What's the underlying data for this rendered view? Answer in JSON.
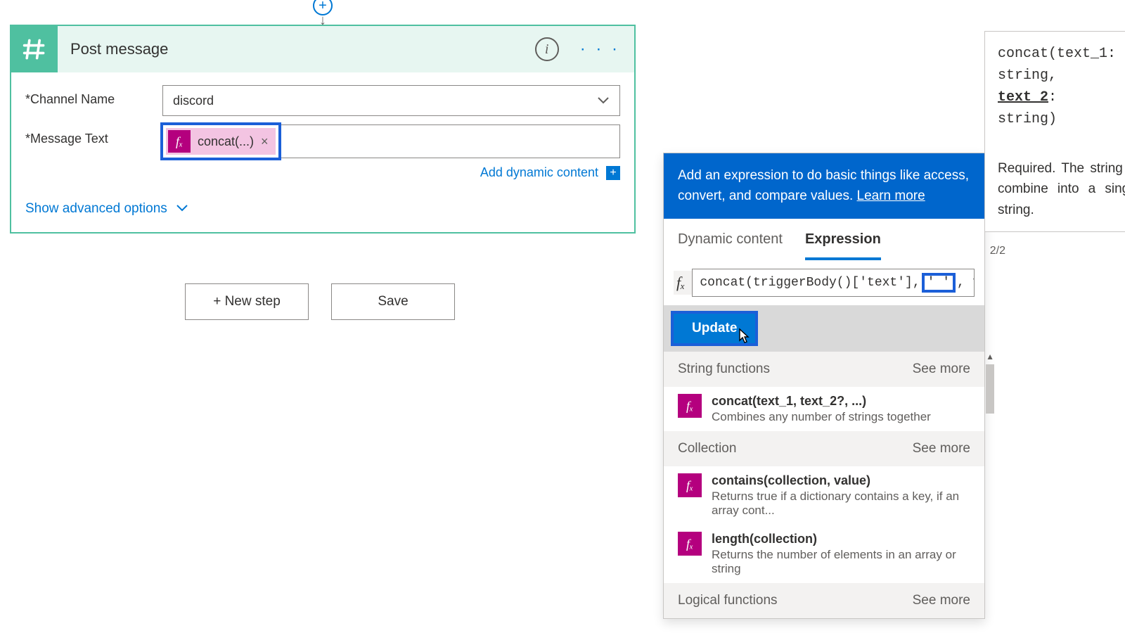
{
  "connector": {
    "plus": "+"
  },
  "card": {
    "title": "Post message",
    "info": "i",
    "more": "· · ·",
    "fields": {
      "channel_label": "Channel Name",
      "channel_value": "discord",
      "message_label": "Message Text",
      "chip_label": "concat(...)",
      "chip_x": "×"
    },
    "dyn_link": "Add dynamic content",
    "dyn_plus": "+",
    "adv": "Show advanced options"
  },
  "footer": {
    "new_step": "+ New step",
    "save": "Save"
  },
  "panel": {
    "banner_text": "Add an expression to do basic things like access, convert, and compare values. ",
    "banner_link": "Learn more",
    "tab_dynamic": "Dynamic content",
    "tab_expression": "Expression",
    "counter": "2/2",
    "fx": "fₓ",
    "expr_before": "concat(triggerBody()['text'],",
    "expr_quote": "' '",
    "expr_after": ", trigger",
    "update": "Update",
    "sections": {
      "string": {
        "title": "String functions",
        "see_more": "See more",
        "items": [
          {
            "sig": "concat(text_1, text_2?, ...)",
            "desc": "Combines any number of strings together"
          }
        ]
      },
      "collection": {
        "title": "Collection",
        "see_more": "See more",
        "items": [
          {
            "sig": "contains(collection, value)",
            "desc": "Returns true if a dictionary contains a key, if an array cont..."
          },
          {
            "sig": "length(collection)",
            "desc": "Returns the number of elements in an array or string"
          }
        ]
      },
      "logical": {
        "title": "Logical functions",
        "see_more": "See more"
      }
    }
  },
  "sig": {
    "line1": "concat(text_1:",
    "line2": "string,",
    "line3_param": "text_2",
    "line3_suffix": ":",
    "line4": "string)",
    "desc": "Required. The string to combine into a single string."
  }
}
